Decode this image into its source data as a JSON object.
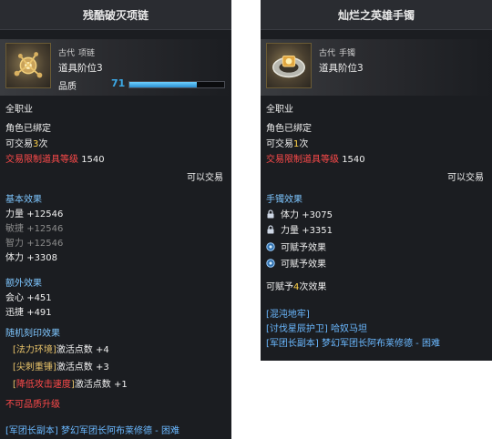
{
  "left": {
    "title": "残酷破灭项链",
    "grade": "古代",
    "type": "项链",
    "tier": "道具阶位3",
    "quality_label": "品质",
    "quality_value": "71",
    "quality_fraction": 0.71,
    "class": "全职业",
    "bound": "角色已绑定",
    "trade_prefix": "可交易",
    "trade_count": "3",
    "trade_suffix": "次",
    "trade_limit_label": "交易限制道具等级",
    "trade_limit_value": "1540",
    "tradable": "可以交易",
    "basic_title": "基本效果",
    "basic_stats": [
      {
        "name": "力量",
        "value": "+12546"
      },
      {
        "name": "敏捷",
        "value": "+12546"
      },
      {
        "name": "智力",
        "value": "+12546"
      },
      {
        "name": "体力",
        "value": "+3308"
      }
    ],
    "extra_title": "额外效果",
    "extra_stats": [
      {
        "name": "会心",
        "value": "+451"
      },
      {
        "name": "迅捷",
        "value": "+491"
      }
    ],
    "engrave_title": "随机刻印效果",
    "engravings": [
      {
        "name": "法力环境",
        "points_label": "激活点数",
        "points": "+4"
      },
      {
        "name": "尖刺重锤",
        "points_label": "激活点数",
        "points": "+3"
      },
      {
        "name": "降低攻击速度",
        "points_label": "激活点数",
        "points": "+1"
      }
    ],
    "no_upgrade": "不可品质升级",
    "source_tag": "[军团长副本]",
    "source_text": "梦幻军团长阿布莱修德 - 困难"
  },
  "right": {
    "title": "灿烂之英雄手镯",
    "grade": "古代",
    "type": "手镯",
    "tier": "道具阶位3",
    "class": "全职业",
    "bound": "角色已绑定",
    "trade_prefix": "可交易",
    "trade_count": "1",
    "trade_suffix": "次",
    "trade_limit_label": "交易限制道具等级",
    "trade_limit_value": "1540",
    "tradable": "可以交易",
    "bracelet_title": "手镯效果",
    "locked_stats": [
      {
        "name": "体力",
        "value": "+3075"
      },
      {
        "name": "力量",
        "value": "+3351"
      }
    ],
    "grantable": [
      "可赋予效果",
      "可赋予效果"
    ],
    "grant_prefix": "可赋予",
    "grant_count": "4",
    "grant_suffix": "次效果",
    "sources": [
      "[混沌地牢]",
      "[讨伐星辰护卫] 哈奴马坦",
      "[军团长副本] 梦幻军团长阿布莱修德 - 困难"
    ]
  }
}
